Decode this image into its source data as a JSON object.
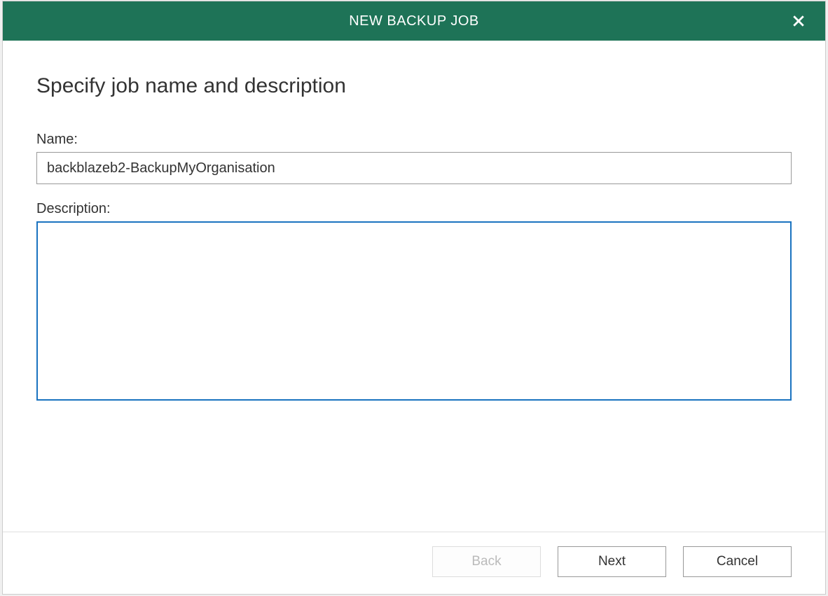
{
  "titlebar": {
    "title": "NEW BACKUP JOB"
  },
  "content": {
    "heading": "Specify job name and description",
    "name_label": "Name:",
    "name_value": "backblazeb2-BackupMyOrganisation",
    "description_label": "Description:",
    "description_value": ""
  },
  "footer": {
    "back_label": "Back",
    "next_label": "Next",
    "cancel_label": "Cancel"
  }
}
